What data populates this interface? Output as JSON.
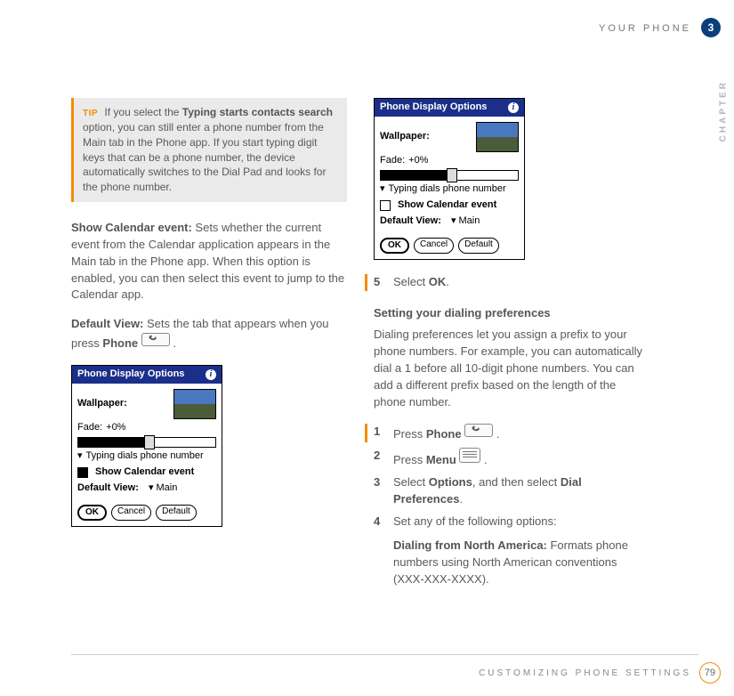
{
  "header": {
    "section": "YOUR PHONE",
    "chapter_number": "3",
    "chapter_label": "CHAPTER"
  },
  "tip": {
    "label": "TIP",
    "bold1": "Typing starts contacts search",
    "text_before": "If you select the ",
    "text_after": " option, you can still enter a phone number from the Main tab in the Phone app. If you start typing digit keys that can be a phone number, the device automatically switches to the Dial Pad and looks for the phone number."
  },
  "left": {
    "p1_bold": "Show Calendar event:",
    "p1_text": " Sets whether the current event from the Calendar application appears in the Main tab in the Phone app. When this option is enabled, you can then select this event to jump to the Calendar app.",
    "p2_bold": "Default View:",
    "p2_text_a": " Sets the tab that appears when you press ",
    "p2_bold2": "Phone",
    "p2_text_b": " ."
  },
  "palm": {
    "title": "Phone Display Options",
    "wallpaper": "Wallpaper:",
    "fade": "Fade:",
    "fade_val": "+0%",
    "typing": "Typing dials phone number",
    "show_cal": "Show Calendar event",
    "default_view": "Default View:",
    "default_val": "Main",
    "ok": "OK",
    "cancel": "Cancel",
    "default_btn": "Default"
  },
  "right": {
    "step5": "Select ",
    "step5_bold": "OK",
    "step5_after": ".",
    "subhead": "Setting your dialing preferences",
    "intro": "Dialing preferences let you assign a prefix to your phone numbers. For example, you can automatically dial a 1 before all 10-digit phone numbers. You can add a different prefix based on the length of the phone number.",
    "s1_a": "Press ",
    "s1_bold": "Phone",
    "s1_b": " .",
    "s2_a": "Press ",
    "s2_bold": "Menu",
    "s2_b": " .",
    "s3_a": "Select ",
    "s3_bold1": "Options",
    "s3_mid": ", and then select ",
    "s3_bold2": "Dial Preferences",
    "s3_end": ".",
    "s4": "Set any of the following options:",
    "p_bold": "Dialing from North America:",
    "p_text": " Formats phone numbers using North American conventions (XXX-XXX-XXXX)."
  },
  "footer": {
    "section": "CUSTOMIZING PHONE SETTINGS",
    "page": "79"
  }
}
